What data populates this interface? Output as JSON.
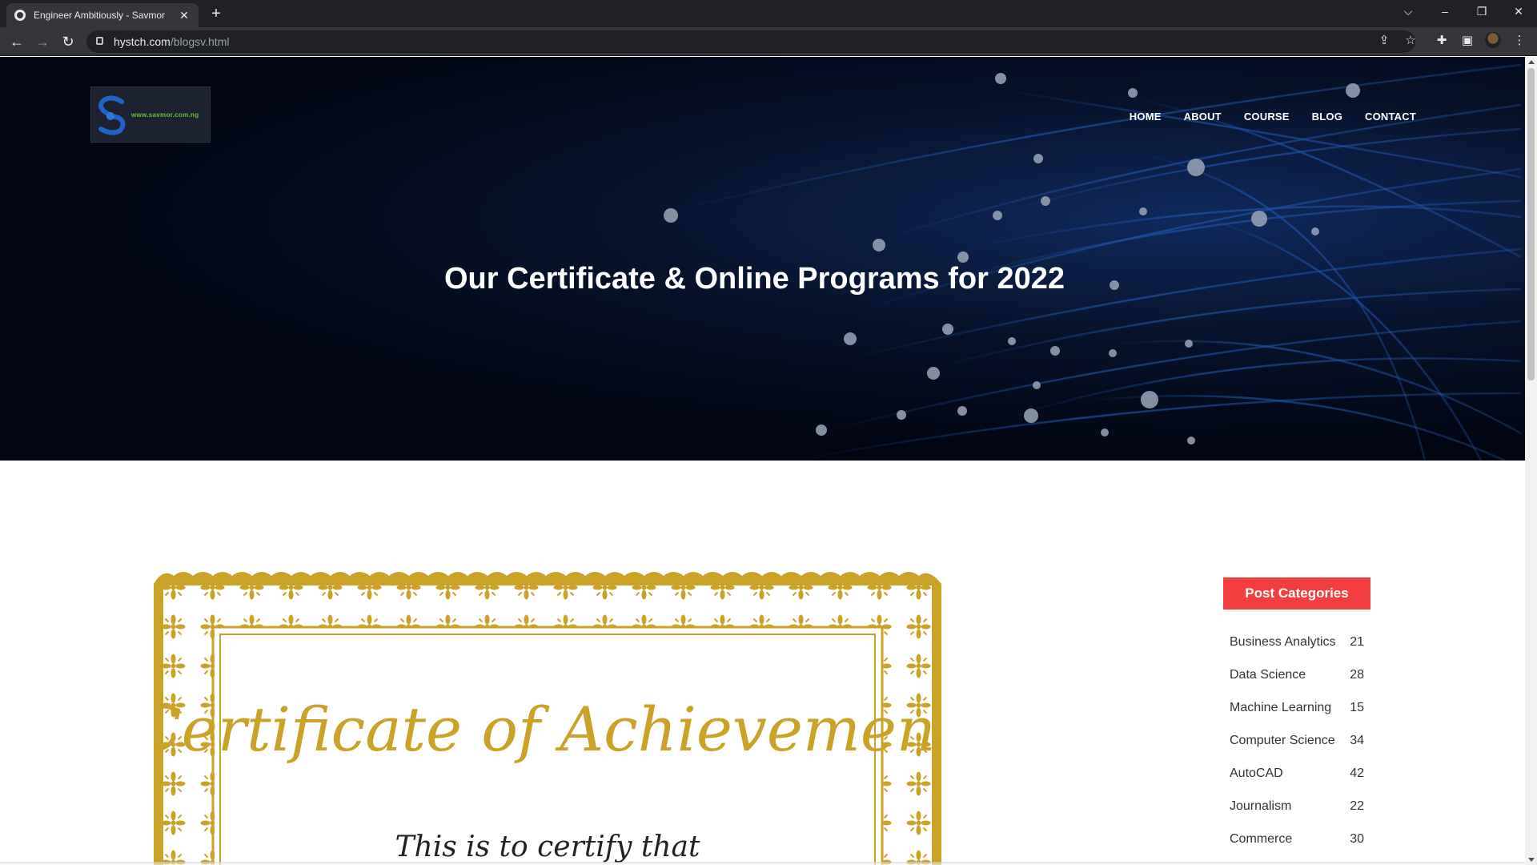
{
  "browser": {
    "tab_title": "Engineer Ambitiously - Savmor",
    "tab_close": "✕",
    "new_tab": "+",
    "url_host": "hystch.com",
    "url_path": "/blogsv.html",
    "window_controls": {
      "tab_search": "⌵",
      "minimize": "–",
      "restore": "❐",
      "close": "✕"
    },
    "toolbar_icons": [
      "back-icon",
      "forward-icon",
      "reload-icon",
      "lock-icon",
      "share-icon",
      "star-icon",
      "extensions-icon",
      "side-panel-icon",
      "profile-avatar",
      "menu-icon"
    ]
  },
  "header": {
    "logo_text": "www.savmor.com.ng",
    "nav": [
      "HOME",
      "ABOUT",
      "COURSE",
      "BLOG",
      "CONTACT"
    ],
    "hero_title": "Our Certificate & Online Programs for 2022"
  },
  "certificate": {
    "heading": "Certificate of Achievement",
    "subheading": "This is to certify that",
    "colors": {
      "gold": "#c9a227",
      "paper": "#ffffff"
    }
  },
  "sidebar": {
    "title": "Post Categories",
    "categories": [
      {
        "name": "Business Analytics",
        "count": "21"
      },
      {
        "name": "Data Science",
        "count": "28"
      },
      {
        "name": "Machine Learning",
        "count": "15"
      },
      {
        "name": "Computer Science",
        "count": "34"
      },
      {
        "name": "AutoCAD",
        "count": "42"
      },
      {
        "name": "Journalism",
        "count": "22"
      },
      {
        "name": "Commerce",
        "count": "30"
      }
    ]
  },
  "colors": {
    "accent": "#f23e3e",
    "hero_dark": "#020512",
    "hero_blue": "#0e2a5a"
  }
}
